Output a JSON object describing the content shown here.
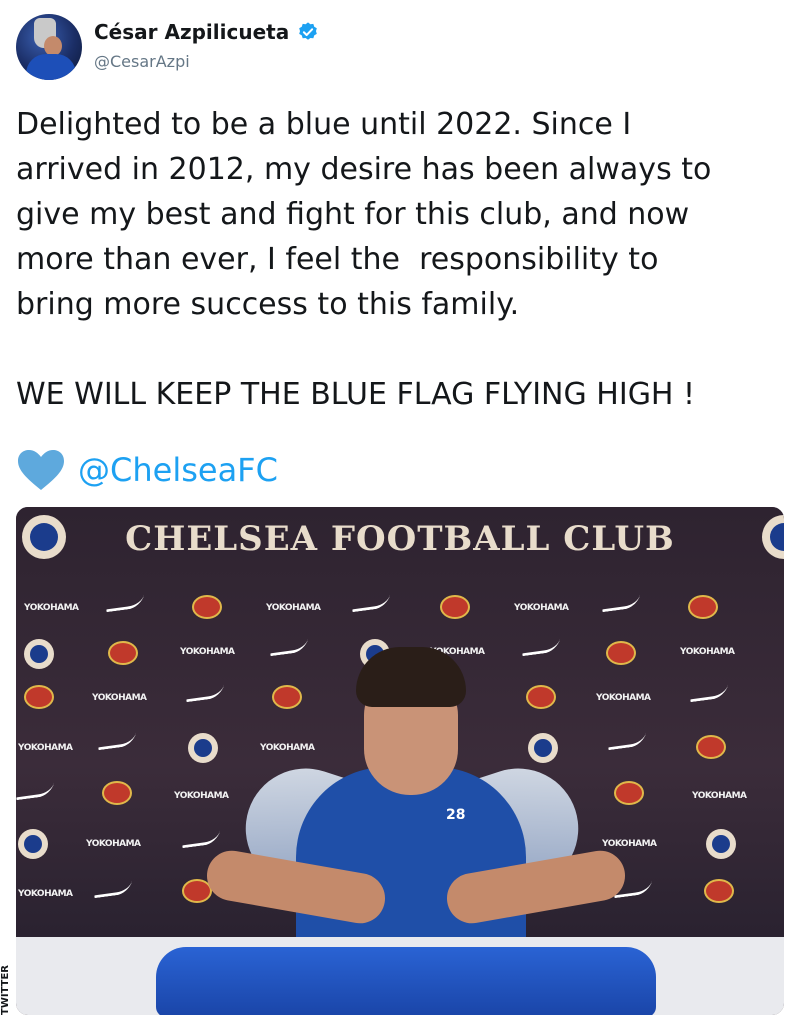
{
  "author": {
    "display_name": "César Azpilicueta",
    "handle": "@CesarAzpi",
    "verified_icon": "verified-badge-icon",
    "avatar_icon": "profile-avatar"
  },
  "tweet": {
    "text": "Delighted to be a blue until 2022. Since I\narrived in 2012, my desire has been always to\ngive my best and fight for this club, and now\nmore than ever, I feel the  responsibility to\nbring more success to this family.\n\nWE WILL KEEP THE BLUE FLAG FLYING HIGH !",
    "heart_icon": "blue-heart-icon",
    "mention": "@ChelseaFC"
  },
  "photo": {
    "backdrop_title": "CHELSEA FOOTBALL CLUB",
    "sponsor_text": "YOKOHAMA",
    "shirt_number": "28"
  },
  "credit": "TWITTER",
  "colors": {
    "link_blue": "#1da1f2",
    "verified_blue": "#1da1f2",
    "heart_blue": "#5ea9dd",
    "text": "#14171a",
    "muted": "#657786"
  }
}
